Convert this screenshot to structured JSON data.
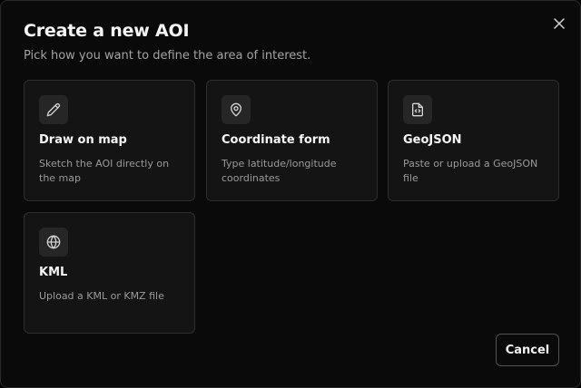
{
  "dialog": {
    "title": "Create a new AOI",
    "subtitle": "Pick how you want to define the area of interest.",
    "close_icon": "close-icon",
    "cancel_label": "Cancel"
  },
  "options": [
    {
      "icon": "pencil-icon",
      "title": "Draw on map",
      "description": "Sketch the AOI directly on the map"
    },
    {
      "icon": "map-pin-icon",
      "title": "Coordinate form",
      "description": "Type latitude/longitude coordinates"
    },
    {
      "icon": "file-code-icon",
      "title": "GeoJSON",
      "description": "Paste or upload a GeoJSON file"
    },
    {
      "icon": "globe-icon",
      "title": "KML",
      "description": "Upload a KML or KMZ file"
    }
  ],
  "colors": {
    "background": "#0a0a0a",
    "card": "#141414",
    "card_border": "#2e2e2e",
    "icon_box": "#262626",
    "text_primary": "#f5f5f5",
    "text_secondary": "#9a9a9a"
  }
}
